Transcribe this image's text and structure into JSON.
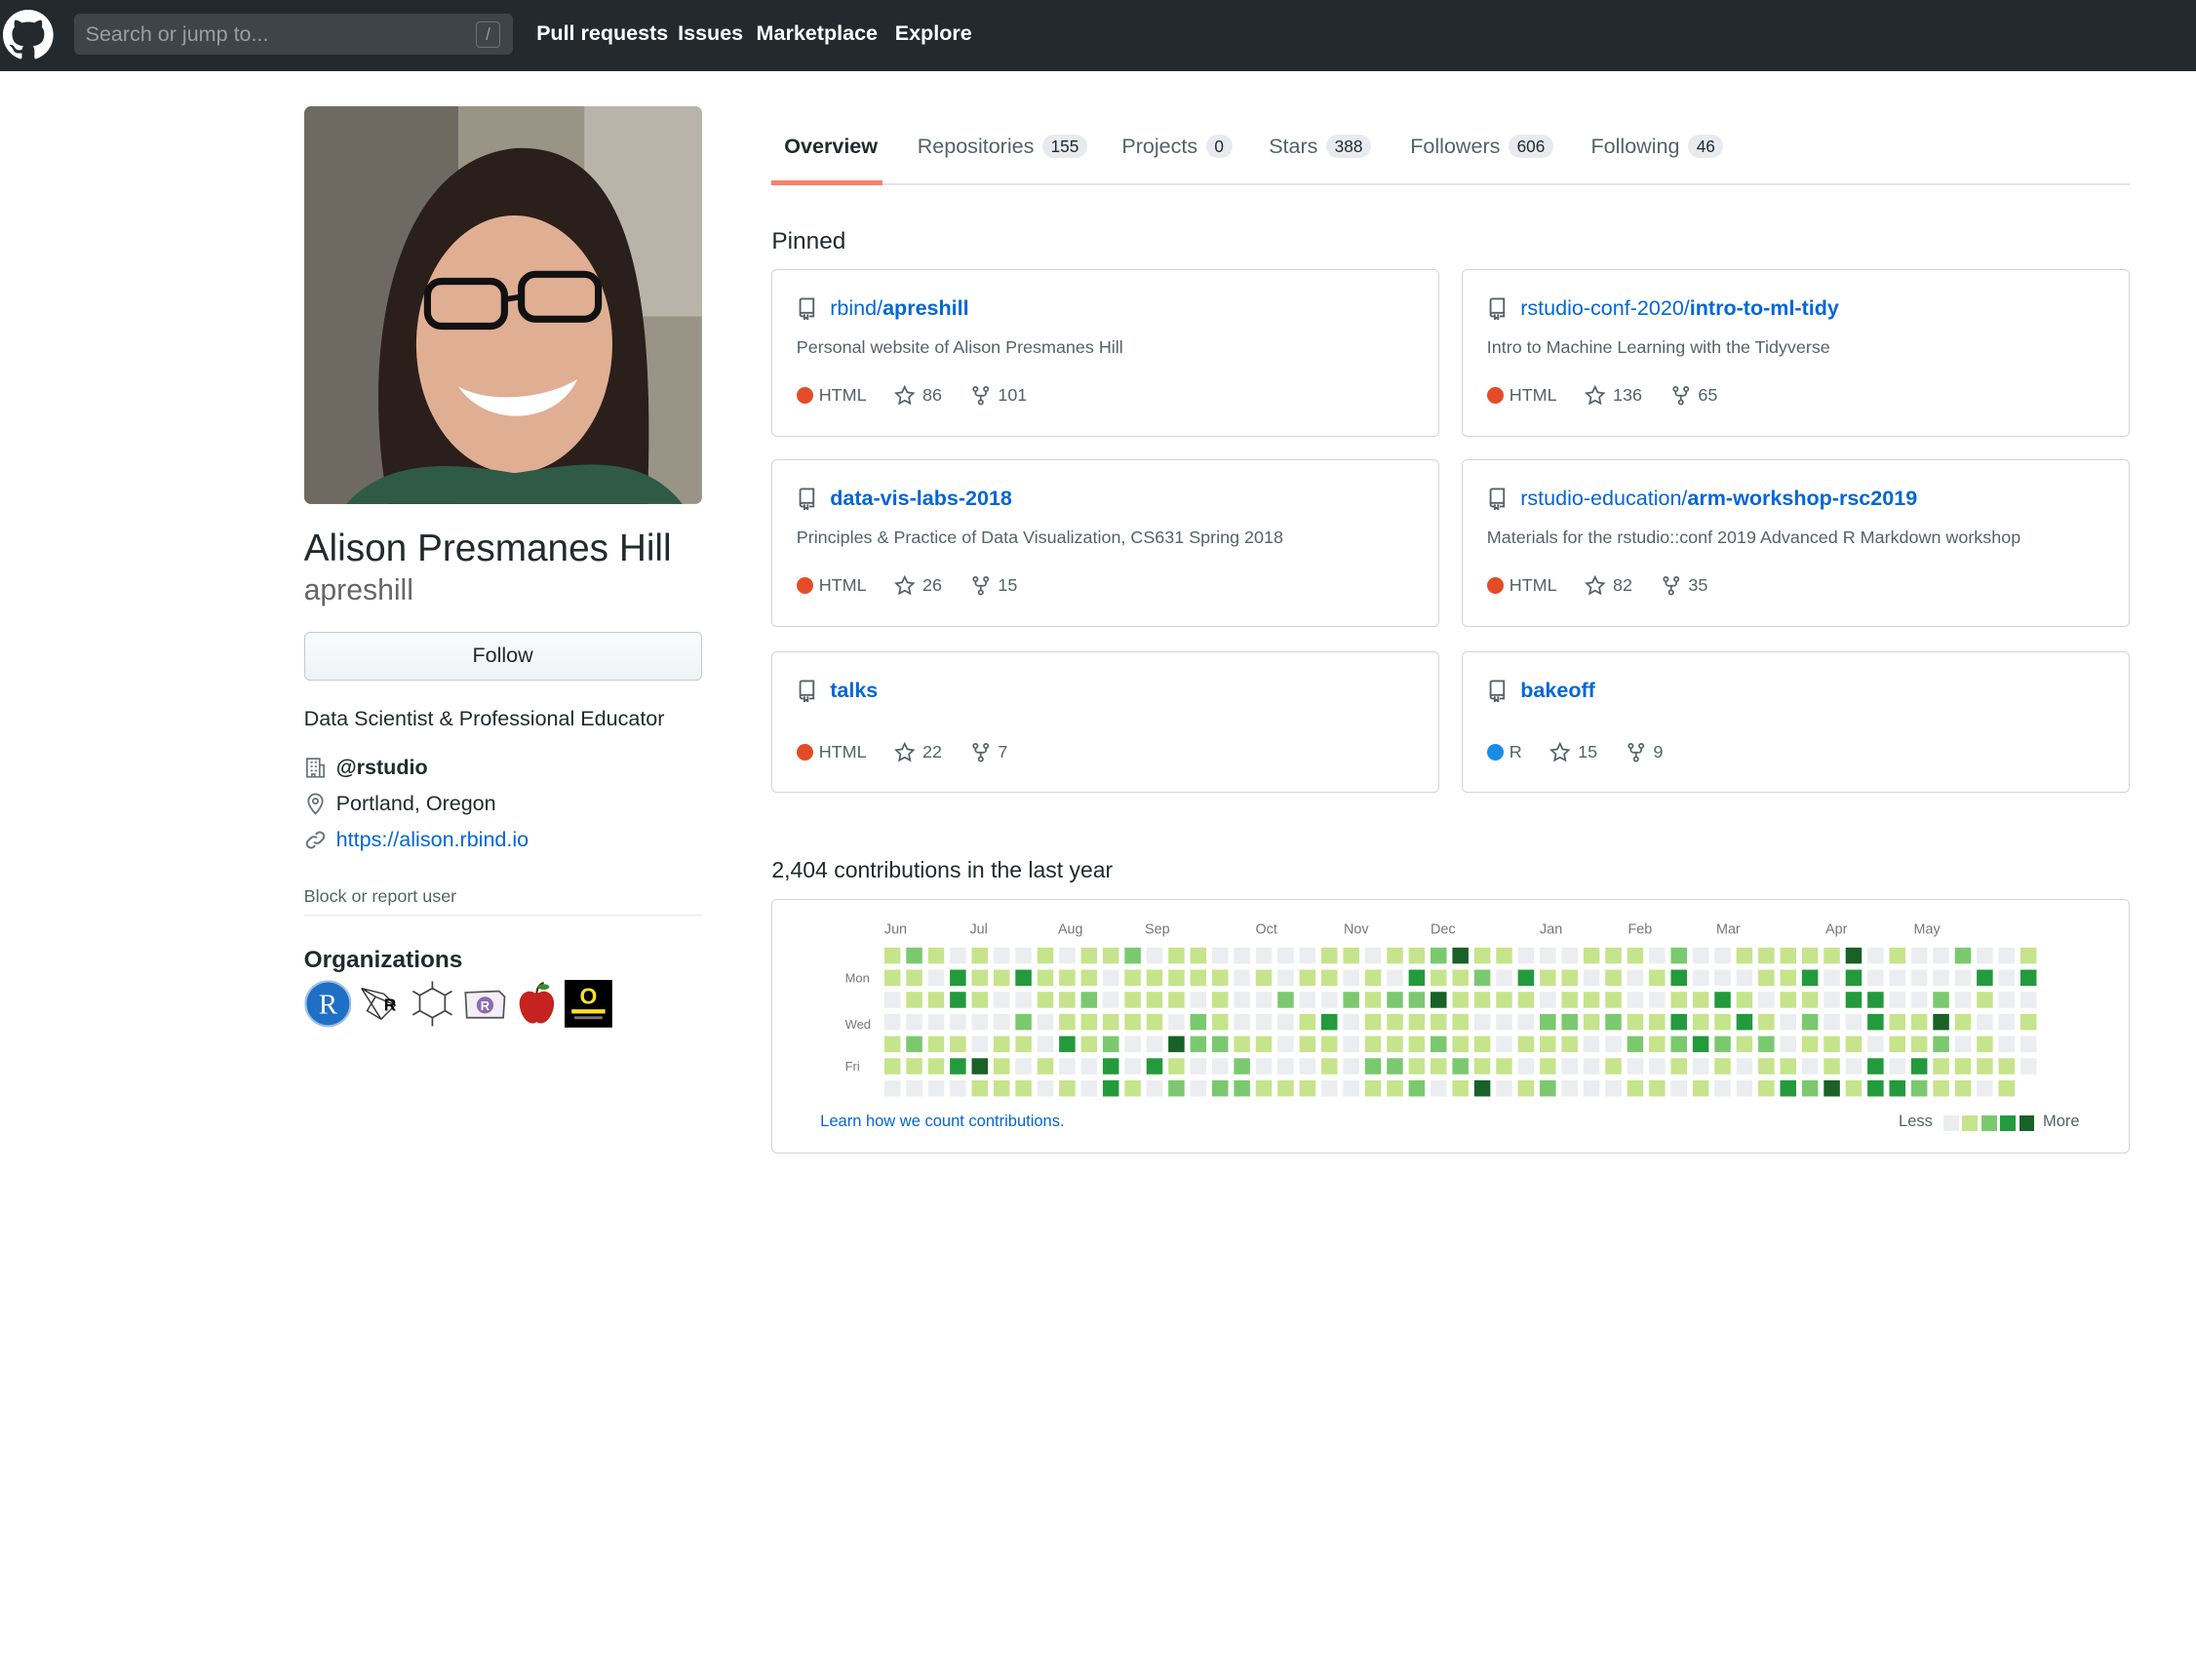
{
  "header": {
    "search_placeholder": "Search or jump to...",
    "search_shortcut": "/",
    "nav": [
      "Pull requests",
      "Issues",
      "Marketplace",
      "Explore"
    ]
  },
  "profile": {
    "fullname": "Alison Presmanes Hill",
    "username": "apreshill",
    "follow_label": "Follow",
    "bio": "Data Scientist & Professional Educator",
    "company": "@rstudio",
    "location": "Portland, Oregon",
    "website": "https://alison.rbind.io",
    "block_label": "Block or report user",
    "orgs_title": "Organizations"
  },
  "tabs": [
    {
      "label": "Overview",
      "count": ""
    },
    {
      "label": "Repositories",
      "count": "155"
    },
    {
      "label": "Projects",
      "count": "0"
    },
    {
      "label": "Stars",
      "count": "388"
    },
    {
      "label": "Followers",
      "count": "606"
    },
    {
      "label": "Following",
      "count": "46"
    }
  ],
  "pinned_title": "Pinned",
  "pinned": [
    {
      "owner": "rbind/",
      "name": "apreshill",
      "desc": "Personal website of Alison Presmanes Hill",
      "lang": "HTML",
      "lang_color": "#e34c26",
      "stars": "86",
      "forks": "101"
    },
    {
      "owner": "rstudio-conf-2020/",
      "name": "intro-to-ml-tidy",
      "desc": "Intro to Machine Learning with the Tidyverse",
      "lang": "HTML",
      "lang_color": "#e34c26",
      "stars": "136",
      "forks": "65"
    },
    {
      "owner": "",
      "name": "data-vis-labs-2018",
      "desc": "Principles & Practice of Data Visualization, CS631 Spring 2018",
      "lang": "HTML",
      "lang_color": "#e34c26",
      "stars": "26",
      "forks": "15"
    },
    {
      "owner": "rstudio-education/",
      "name": "arm-workshop-rsc2019",
      "desc": "Materials for the rstudio::conf 2019 Advanced R Markdown workshop",
      "lang": "HTML",
      "lang_color": "#e34c26",
      "stars": "82",
      "forks": "35"
    },
    {
      "owner": "",
      "name": "talks",
      "desc": "",
      "lang": "HTML",
      "lang_color": "#e34c26",
      "stars": "22",
      "forks": "7"
    },
    {
      "owner": "",
      "name": "bakeoff",
      "desc": "",
      "lang": "R",
      "lang_color": "#198ce7",
      "stars": "15",
      "forks": "9"
    }
  ],
  "contributions": {
    "title": "2,404 contributions in the last year",
    "months": [
      "Jun",
      "Jul",
      "Aug",
      "Sep",
      "Oct",
      "Nov",
      "Dec",
      "Jan",
      "Feb",
      "Mar",
      "Apr",
      "May"
    ],
    "days": [
      "Mon",
      "Wed",
      "Fri"
    ],
    "learn_label": "Learn how we count contributions.",
    "less_label": "Less",
    "more_label": "More",
    "level_colors": [
      "#ebedf0",
      "#c6e48b",
      "#7bc96f",
      "#239a3b",
      "#196127"
    ]
  }
}
